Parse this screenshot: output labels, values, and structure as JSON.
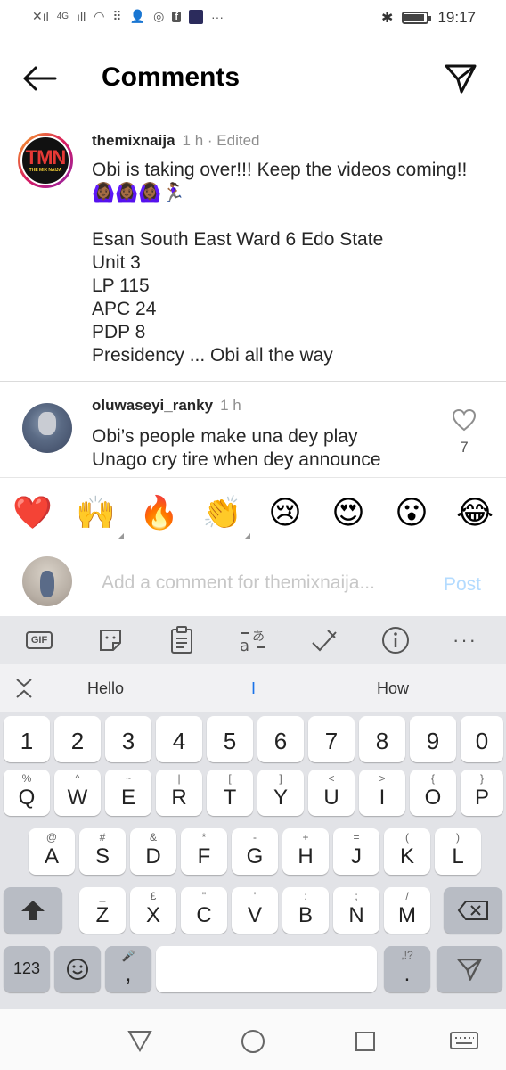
{
  "status_bar": {
    "time": "19:17",
    "network": "4G"
  },
  "header": {
    "title": "Comments"
  },
  "comments": [
    {
      "username": "themixnaija",
      "meta": "1 h · Edited",
      "avatar_text": "TMN",
      "avatar_subtext": "THE MIX NAIJA",
      "text": "Obi is taking over!!! Keep the videos coming!!🙆🏾‍♀️🙆🏾‍♀️🙆🏾‍♀️🏃🏾‍♀️\n\nEsan South East Ward 6 Edo State\nUnit 3\nLP 115\nAPC 24\nPDP 8\nPresidency ... Obi all the way"
    },
    {
      "username": "oluwaseyi_ranky",
      "meta": "1 h",
      "text": "Obi’s people make una dey play\nUnago cry tire when dey announce",
      "likes": "7"
    }
  ],
  "emoji_bar": [
    "❤️",
    "🙌",
    "🔥",
    "👏",
    "😢",
    "😍",
    "😮",
    "😂"
  ],
  "add_comment": {
    "placeholder": "Add a comment for themixnaija...",
    "post_label": "Post"
  },
  "keyboard": {
    "tools": [
      "gif-icon",
      "sticker-icon",
      "clipboard-icon",
      "translate-icon",
      "handwriting-icon",
      "info-icon",
      "more-icon"
    ],
    "gif_label": "GIF",
    "suggestions": [
      "Hello",
      "I",
      "How"
    ],
    "number_row": [
      "1",
      "2",
      "3",
      "4",
      "5",
      "6",
      "7",
      "8",
      "9",
      "0"
    ],
    "row1": [
      {
        "main": "Q",
        "sub": "%"
      },
      {
        "main": "W",
        "sub": "^"
      },
      {
        "main": "E",
        "sub": "~"
      },
      {
        "main": "R",
        "sub": "|"
      },
      {
        "main": "T",
        "sub": "["
      },
      {
        "main": "Y",
        "sub": "]"
      },
      {
        "main": "U",
        "sub": "<"
      },
      {
        "main": "I",
        "sub": ">"
      },
      {
        "main": "O",
        "sub": "{"
      },
      {
        "main": "P",
        "sub": "}"
      }
    ],
    "row2": [
      {
        "main": "A",
        "sub": "@"
      },
      {
        "main": "S",
        "sub": "#"
      },
      {
        "main": "D",
        "sub": "&"
      },
      {
        "main": "F",
        "sub": "*"
      },
      {
        "main": "G",
        "sub": "-"
      },
      {
        "main": "H",
        "sub": "+"
      },
      {
        "main": "J",
        "sub": "="
      },
      {
        "main": "K",
        "sub": "("
      },
      {
        "main": "L",
        "sub": ")"
      }
    ],
    "row3": [
      {
        "main": "Z",
        "sub": "_"
      },
      {
        "main": "X",
        "sub": "£"
      },
      {
        "main": "C",
        "sub": "\""
      },
      {
        "main": "V",
        "sub": "'"
      },
      {
        "main": "B",
        "sub": ":"
      },
      {
        "main": "N",
        "sub": ";"
      },
      {
        "main": "M",
        "sub": "/"
      }
    ],
    "num_switch": "123",
    "comma": ",",
    "period": ".",
    "period_sub": ",!?"
  }
}
